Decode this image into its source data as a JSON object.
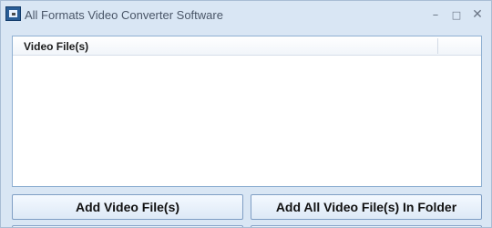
{
  "window": {
    "title": "All Formats Video Converter Software",
    "icon": "app-video-icon",
    "controls": {
      "minimize_glyph": "–",
      "maximize_glyph": "□",
      "close_glyph": "✕"
    }
  },
  "file_list": {
    "columns": [
      "Video File(s)"
    ],
    "rows": []
  },
  "buttons": {
    "add_files_label": "Add Video File(s)",
    "add_folder_label": "Add All Video File(s) In Folder"
  },
  "colors": {
    "window_bg": "#d9e6f4",
    "button_border": "#7f9ec4",
    "list_border": "#8fb0d2"
  }
}
